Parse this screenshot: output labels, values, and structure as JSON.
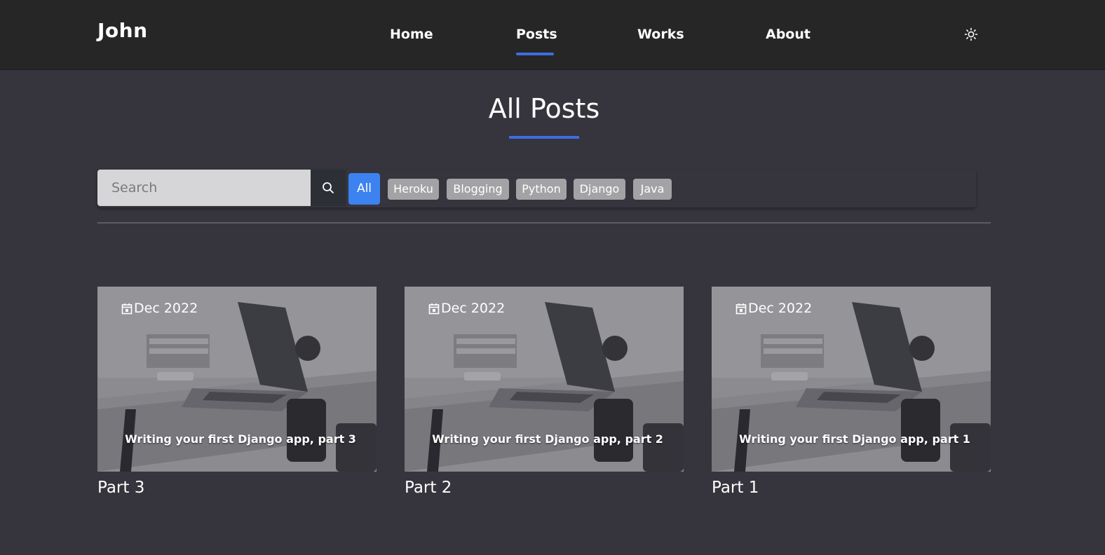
{
  "header": {
    "brand": "John",
    "nav": [
      {
        "label": "Home"
      },
      {
        "label": "Posts",
        "active": true
      },
      {
        "label": "Works"
      },
      {
        "label": "About"
      }
    ],
    "theme_toggle_icon": "sun-icon"
  },
  "page": {
    "title": "All Posts"
  },
  "search": {
    "placeholder": "Search",
    "value": "",
    "button_icon": "search-icon"
  },
  "tags": [
    {
      "label": "All",
      "active": true
    },
    {
      "label": "Heroku"
    },
    {
      "label": "Blogging"
    },
    {
      "label": "Python"
    },
    {
      "label": "Django"
    },
    {
      "label": "Java"
    }
  ],
  "posts": [
    {
      "date": "Dec 2022",
      "caption": "Writing your first Django app, part 3",
      "title": "Part 3"
    },
    {
      "date": "Dec 2022",
      "caption": "Writing your first Django app, part 2",
      "title": "Part 2"
    },
    {
      "date": "Dec 2022",
      "caption": "Writing your first Django app, part 1",
      "title": "Part 1"
    }
  ],
  "colors": {
    "background": "#36353d",
    "header": "#262626",
    "accent": "#3d6ee0",
    "active_tag": "#3c82f0",
    "tag": "#a3a3a6"
  }
}
